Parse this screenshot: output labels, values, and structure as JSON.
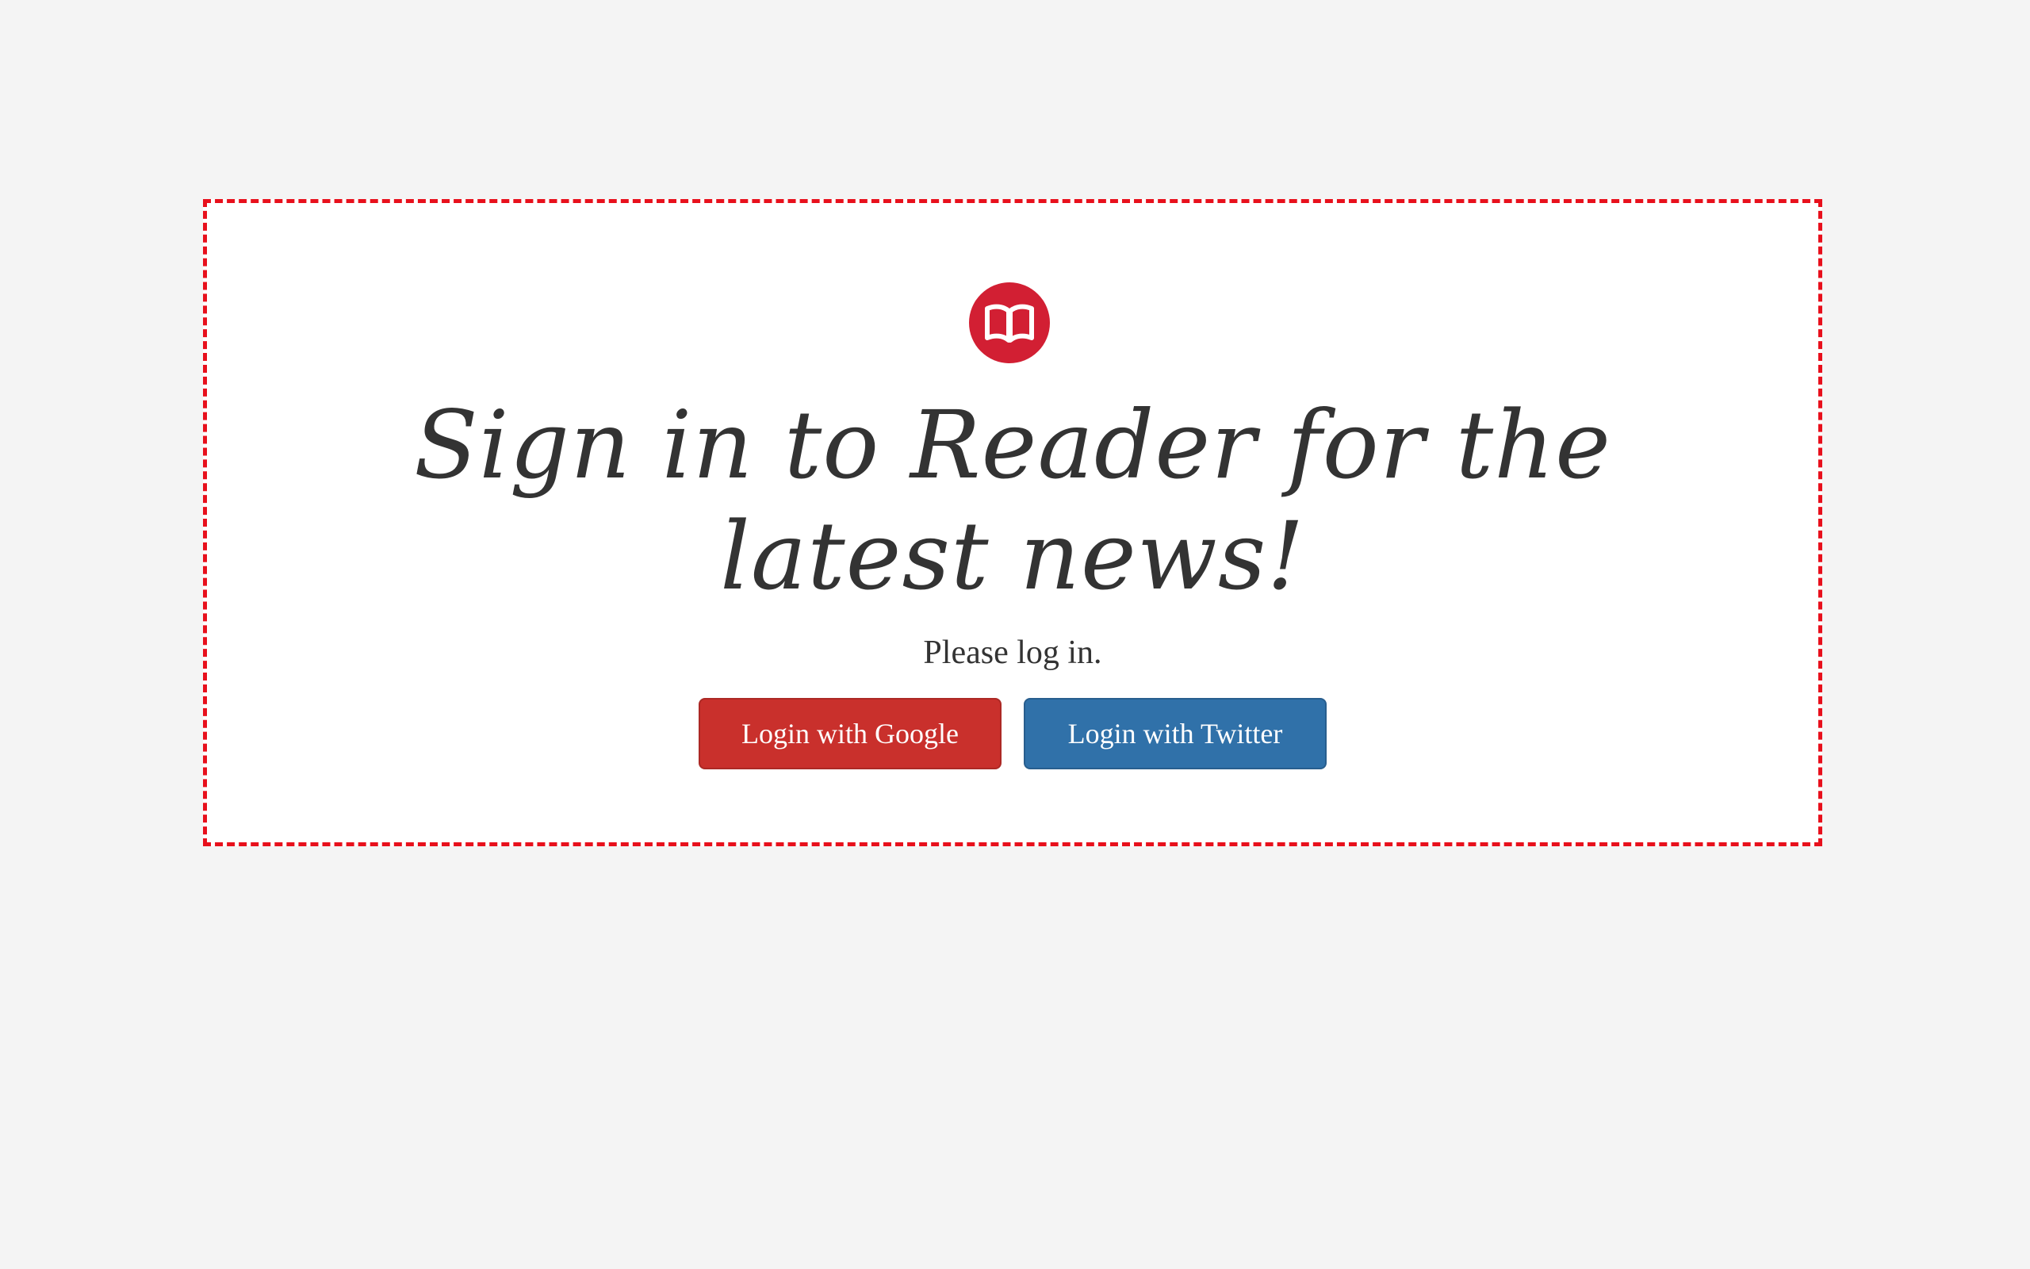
{
  "logo": {
    "icon": "book-icon",
    "color": "#d21f33"
  },
  "headline": "Sign in to Reader for the latest news!",
  "subtext": "Please log in.",
  "buttons": {
    "google": {
      "label": "Login with Google",
      "color": "#c9302c"
    },
    "twitter": {
      "label": "Login with Twitter",
      "color": "#3071a9"
    }
  },
  "colors": {
    "page_background": "#f4f4f4",
    "panel_border": "#e8101c",
    "text": "#333333"
  }
}
